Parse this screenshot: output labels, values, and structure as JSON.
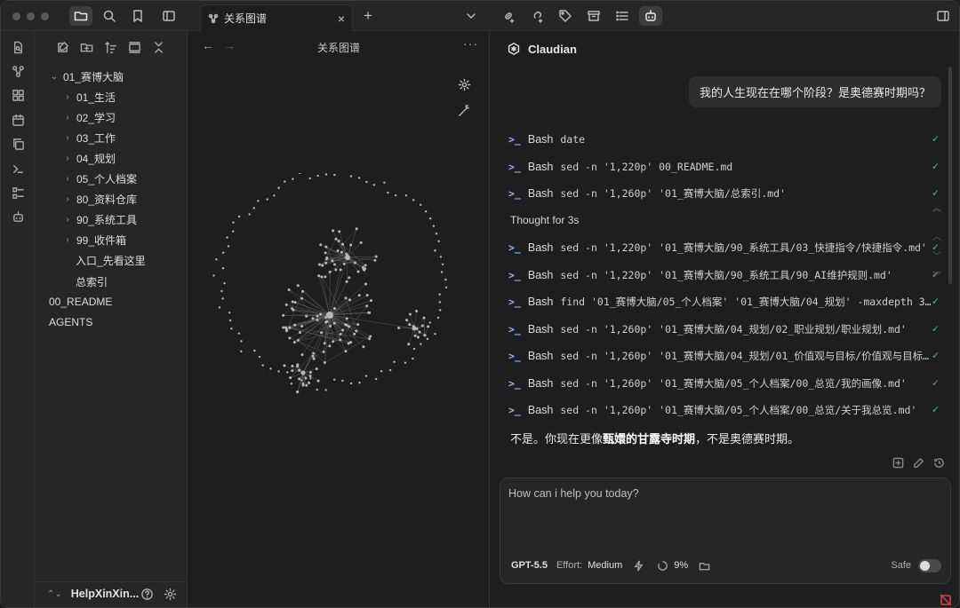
{
  "tab": {
    "title": "关系图谱",
    "close": "×",
    "new": "+"
  },
  "explorer": {
    "tree": [
      {
        "label": "01_赛博大脑",
        "chevron": "⌄",
        "depth": 0
      },
      {
        "label": "01_生活",
        "chevron": "›",
        "depth": 1
      },
      {
        "label": "02_学习",
        "chevron": "›",
        "depth": 1
      },
      {
        "label": "03_工作",
        "chevron": "›",
        "depth": 1
      },
      {
        "label": "04_规划",
        "chevron": "›",
        "depth": 1
      },
      {
        "label": "05_个人档案",
        "chevron": "›",
        "depth": 1
      },
      {
        "label": "80_资料仓库",
        "chevron": "›",
        "depth": 1
      },
      {
        "label": "90_系统工具",
        "chevron": "›",
        "depth": 1
      },
      {
        "label": "99_收件箱",
        "chevron": "›",
        "depth": 1
      },
      {
        "label": "入口_先看这里",
        "chevron": "",
        "depth": 2
      },
      {
        "label": "总索引",
        "chevron": "",
        "depth": 2
      },
      {
        "label": "00_README",
        "chevron": "",
        "depth": 0
      },
      {
        "label": "AGENTS",
        "chevron": "",
        "depth": 0
      }
    ],
    "vault": "HelpXinXin...",
    "vault_switch": "⌃⌄"
  },
  "graph": {
    "title": "关系图谱",
    "more": "···",
    "back": "←",
    "forward": "→"
  },
  "chat": {
    "title": "Claudian",
    "user_message": "我的人生现在在哪个阶段？是奥德赛时期吗？",
    "tools": [
      {
        "prompt": ">_",
        "name": "Bash",
        "cmd": "date",
        "check": "✓"
      },
      {
        "prompt": ">_",
        "name": "Bash",
        "cmd": "sed -n '1,220p' 00_README.md",
        "check": "✓"
      },
      {
        "prompt": ">_",
        "name": "Bash",
        "cmd": "sed -n '1,260p' '01_赛博大脑/总索引.md'",
        "check": "✓"
      },
      {
        "prompt": ">_",
        "name": "Bash",
        "cmd": "sed -n '1,220p' '01_赛博大脑/90_系统工具/03_快捷指令/快捷指令.md'",
        "check": "✓"
      },
      {
        "prompt": ">_",
        "name": "Bash",
        "cmd": "sed -n '1,220p' '01_赛博大脑/90_系统工具/90_AI维护规则.md'",
        "check": "✓"
      },
      {
        "prompt": ">_",
        "name": "Bash",
        "cmd": "find '01_赛博大脑/05_个人档案' '01_赛博大脑/04_规划' -maxdepth 3…",
        "check": "✓"
      },
      {
        "prompt": ">_",
        "name": "Bash",
        "cmd": "sed -n '1,260p' '01_赛博大脑/04_规划/02_职业规划/职业规划.md'",
        "check": "✓"
      },
      {
        "prompt": ">_",
        "name": "Bash",
        "cmd": "sed -n '1,260p' '01_赛博大脑/04_规划/01_价值观与目标/价值观与目标…",
        "check": "✓"
      },
      {
        "prompt": ">_",
        "name": "Bash",
        "cmd": "sed -n '1,260p' '01_赛博大脑/05_个人档案/00_总览/我的画像.md'",
        "check": "✓"
      },
      {
        "prompt": ">_",
        "name": "Bash",
        "cmd": "sed -n '1,260p' '01_赛博大脑/05_个人档案/00_总览/关于我总览.md'",
        "check": "✓"
      }
    ],
    "thought": "Thought for 3s",
    "answer": {
      "pre": "不是。你现在更像",
      "bold": "甄嬛的甘露寺时期",
      "post": "，不是奥德赛时期。"
    },
    "composer": {
      "placeholder": "How can i help you today?",
      "model": "GPT-5.5",
      "effort_label": "Effort:",
      "effort_value": "Medium",
      "context_pct": "9%",
      "safe_label": "Safe"
    }
  },
  "colors": {
    "accent_blue": "#8fb8ff",
    "success_green": "#5fbf6a",
    "bg": "#1e1e1e",
    "panel": "#262626"
  }
}
